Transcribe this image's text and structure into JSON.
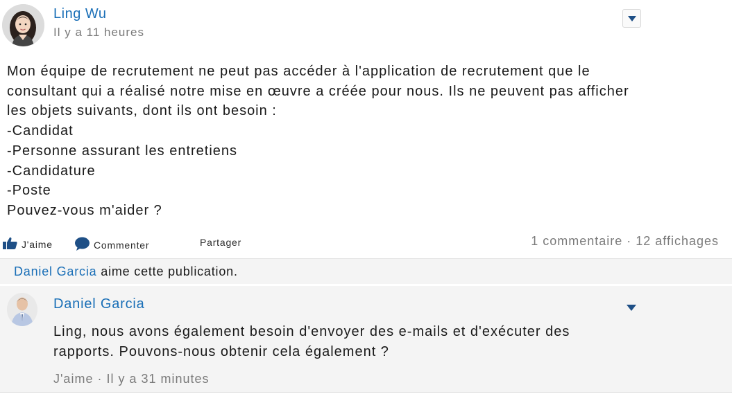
{
  "post": {
    "author": "Ling Wu",
    "timestamp": "Il y a 11 heures",
    "body_lines": [
      "Mon équipe de recrutement ne peut pas accéder à l'application de recrutement que le",
      "consultant qui a réalisé notre mise en œuvre a créée pour nous. Ils ne peuvent pas afficher",
      "les objets suivants, dont ils ont besoin :",
      "-Candidat",
      "-Personne assurant les entretiens",
      "-Candidature",
      "-Poste",
      "Pouvez-vous m'aider ?"
    ]
  },
  "actions": {
    "like_label": "J'aime",
    "comment_label": "Commenter",
    "share_label": "Partager",
    "stats": "1 commentaire · 12 affichages"
  },
  "likes": {
    "name": "Daniel Garcia",
    "suffix": " aime cette publication."
  },
  "comment": {
    "author": "Daniel Garcia",
    "lines": [
      "Ling, nous avons également besoin d'envoyer des e-mails et d'exécuter des",
      "rapports. Pouvons-nous obtenir cela également ?"
    ],
    "footer_like": "J'aime",
    "footer_sep": " · ",
    "footer_time": "Il y a 31 minutes"
  },
  "icons": {
    "post_menu": "chevron-down-icon",
    "comment_menu": "chevron-down-icon",
    "like": "thumbs-up-icon",
    "comment": "speech-bubble-icon"
  },
  "colors": {
    "link": "#1a6fb7",
    "muted": "#7a7a7a",
    "icon": "#1e4f86"
  }
}
